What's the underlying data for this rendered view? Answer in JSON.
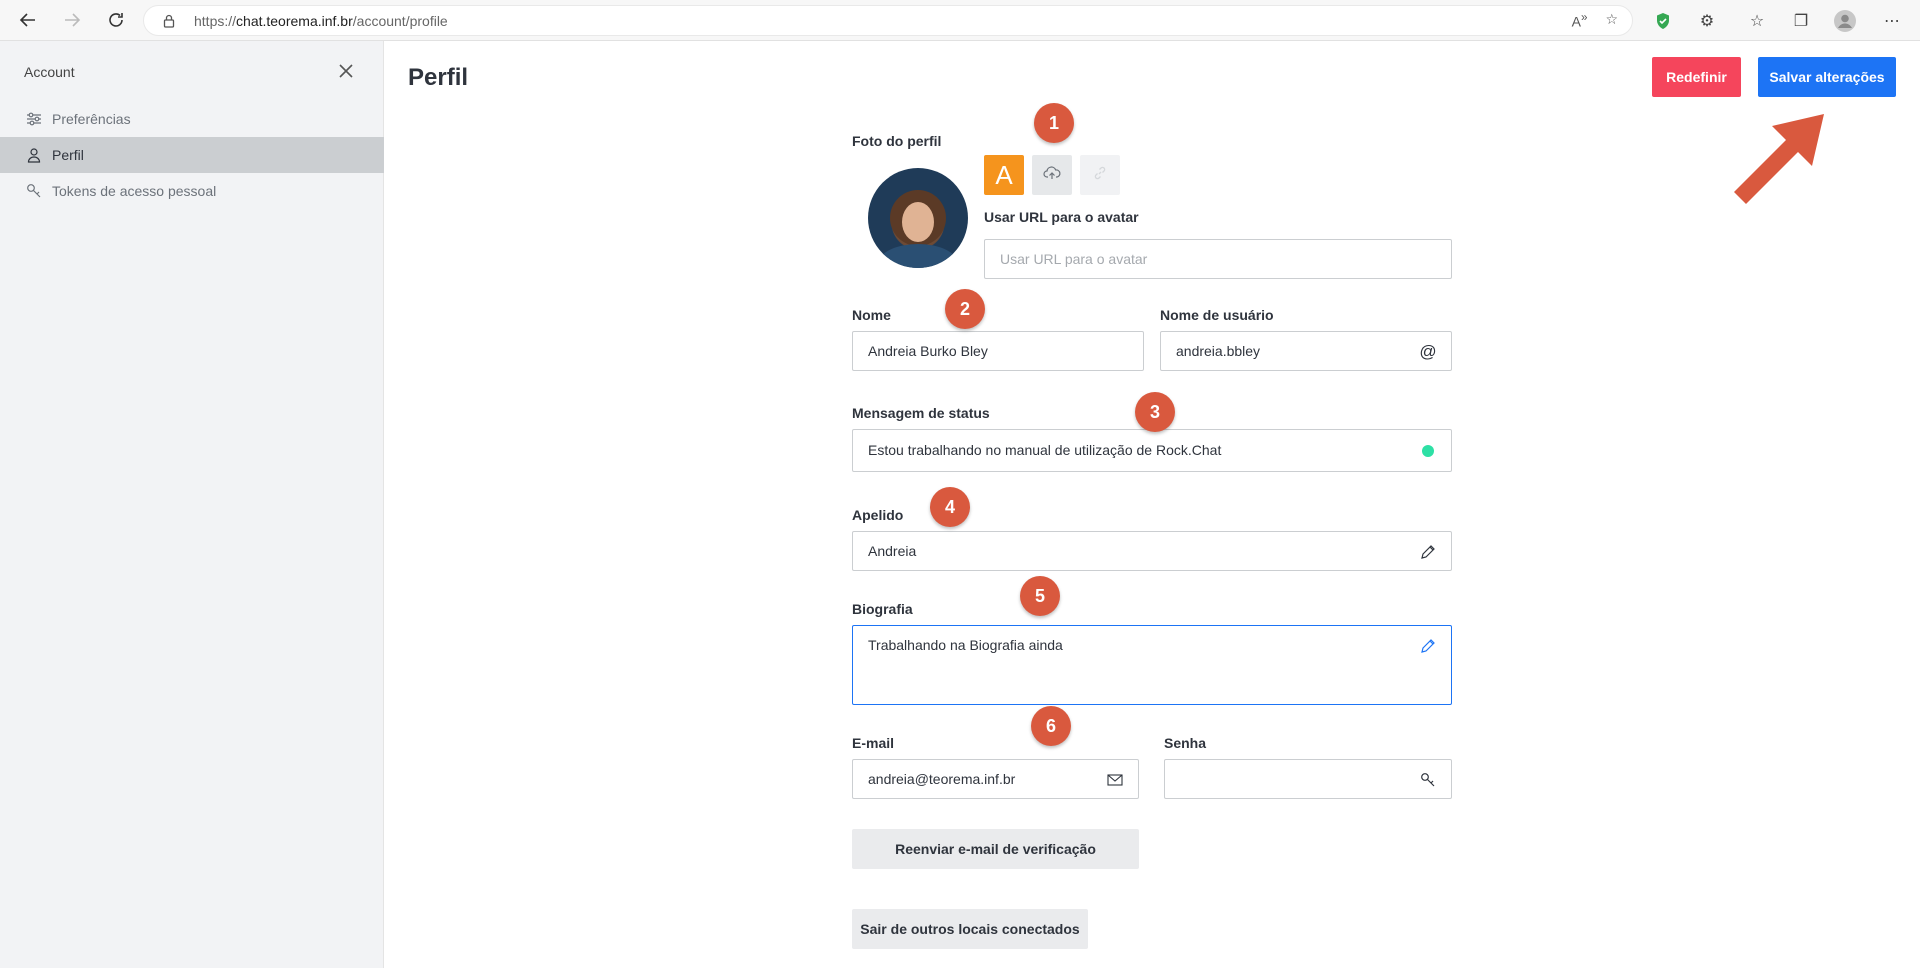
{
  "browser": {
    "url_prefix": "https://",
    "url_host": "chat.teorema.inf.br",
    "url_path": "/account/profile"
  },
  "sidebar": {
    "title": "Account",
    "items": [
      {
        "label": "Preferências",
        "icon": "sliders-icon",
        "active": false
      },
      {
        "label": "Perfil",
        "icon": "user-icon",
        "active": true
      },
      {
        "label": "Tokens de acesso pessoal",
        "icon": "key-icon",
        "active": false
      }
    ]
  },
  "page": {
    "title": "Perfil",
    "reset_label": "Redefinir",
    "save_label": "Salvar alterações"
  },
  "profile": {
    "photo_label": "Foto do perfil",
    "avatar_letter": "A",
    "avatar_url_label": "Usar URL para o avatar",
    "avatar_url_placeholder": "Usar URL para o avatar",
    "name_label": "Nome",
    "name_value": "Andreia Burko Bley",
    "username_label": "Nome de usuário",
    "username_value": "andreia.bbley",
    "status_label": "Mensagem de status",
    "status_value": "Estou trabalhando no manual de utilização de Rock.Chat",
    "nickname_label": "Apelido",
    "nickname_value": "Andreia",
    "bio_label": "Biografia",
    "bio_value": "Trabalhando na Biografia ainda",
    "email_label": "E-mail",
    "email_value": "andreia@teorema.inf.br",
    "password_label": "Senha",
    "resend_label": "Reenviar e-mail de verificação",
    "logout_others_label": "Sair de outros locais conectados"
  },
  "annotations": [
    "1",
    "2",
    "3",
    "4",
    "5",
    "6"
  ],
  "colors": {
    "accent": "#1d74f5",
    "danger": "#f5455c",
    "annotation": "#d9593e",
    "avatar_letter_bg": "#f5941d",
    "online": "#2de0a5"
  }
}
